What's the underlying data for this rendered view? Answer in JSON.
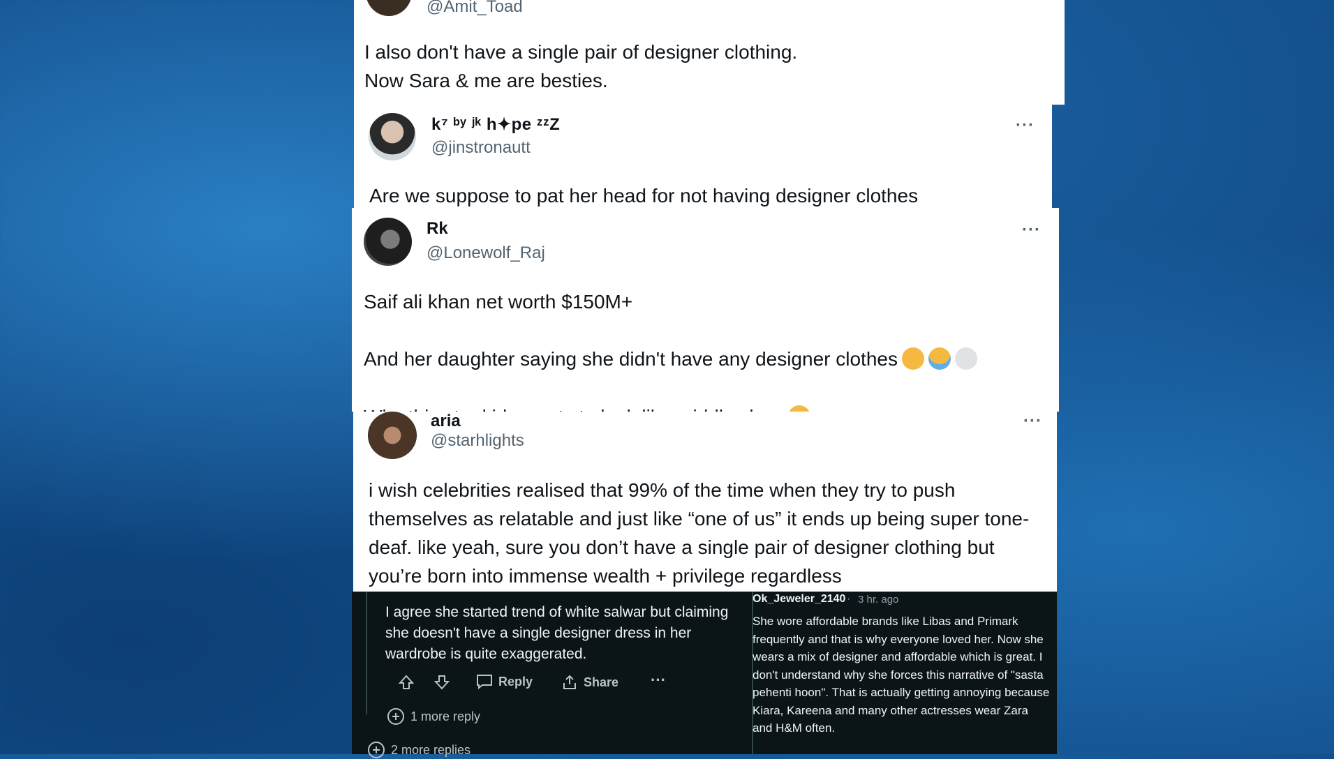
{
  "tweets": [
    {
      "handle": "@Amit_Toad",
      "text": "I also don't have a single pair of designer clothing.\nNow Sara & me are besties."
    },
    {
      "name": "k⁷ ᵇʸ ʲᵏ h✦pe ᶻᶻZ",
      "handle": "@jinstronautt",
      "text": "Are we suppose to pat her head for not having designer clothes"
    },
    {
      "name": "Rk",
      "handle": "@Lonewolf_Raj",
      "line1": "Saif ali khan net worth $150M+",
      "line2": "And her daughter saying she didn't have any designer clothes",
      "line3": "Why this star kids wants to look like middle class"
    },
    {
      "name": "aria",
      "handle": "@starhlights",
      "text": "i wish celebrities realised that 99% of the time when they try to push themselves as relatable and just like “one of us” it ends up being super tone-deaf. like yeah, sure you don’t have a single pair of designer clothing but you’re born into immense wealth + privilege regardless"
    }
  ],
  "reddit_left": {
    "text": "I agree she started trend of white salwar but claiming she doesn't have a single designer dress in her wardrobe is quite exaggerated.",
    "reply_label": "Reply",
    "share_label": "Share",
    "more_reply": "1 more reply",
    "more_replies": "2 more replies"
  },
  "reddit_right": {
    "username": "Ok_Jeweler_2140",
    "time": "3 hr. ago",
    "text": "She wore affordable brands like Libas and Primark frequently and that is why everyone loved her. Now she wears a mix of designer and affordable which is great. I don't understand why she forces this narrative of \"sasta pehenti hoon\". That is actually getting annoying because Kiara, Kareena and many other actresses wear Zara and H&M often."
  },
  "icons": [
    "more-dots-icon",
    "upvote-icon",
    "downvote-icon",
    "comment-icon",
    "share-icon",
    "plus-circle-icon",
    "skull-emoji",
    "crying-emoji",
    "sad-emoji"
  ],
  "colors": {
    "background": "#134f8c",
    "handle": "#536471",
    "reddit_bg": "#0b1416"
  }
}
